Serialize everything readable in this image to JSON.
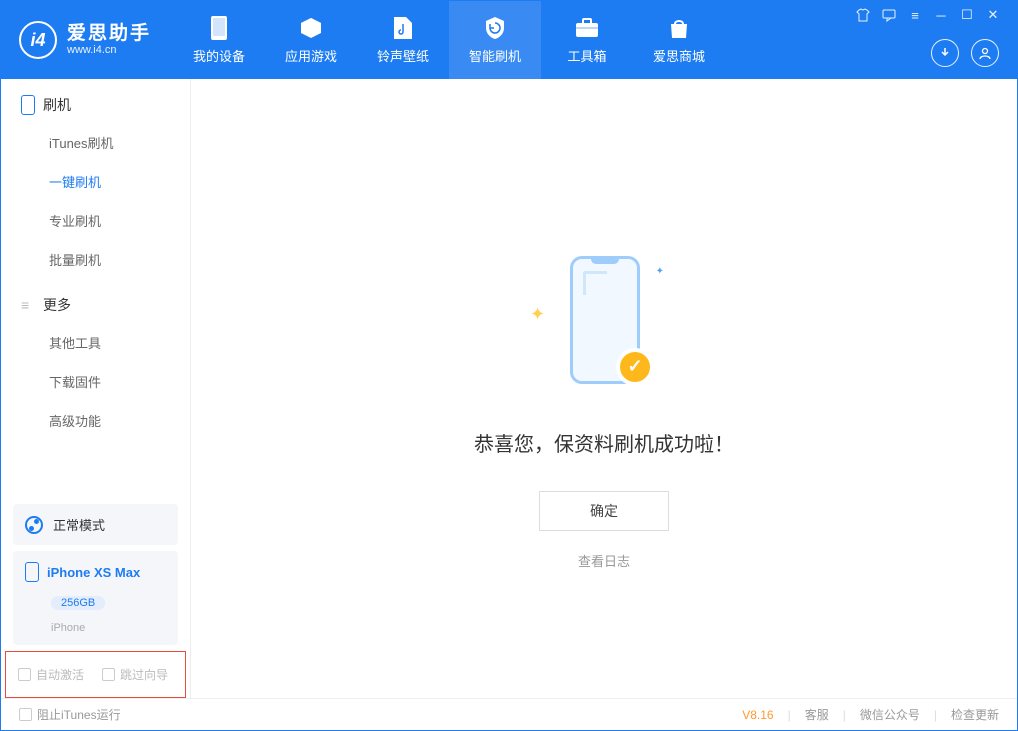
{
  "brand": {
    "name": "爱思助手",
    "url": "www.i4.cn"
  },
  "nav": {
    "items": [
      {
        "label": "我的设备"
      },
      {
        "label": "应用游戏"
      },
      {
        "label": "铃声壁纸"
      },
      {
        "label": "智能刷机"
      },
      {
        "label": "工具箱"
      },
      {
        "label": "爱思商城"
      }
    ]
  },
  "sidebar": {
    "section1": {
      "title": "刷机",
      "items": [
        "iTunes刷机",
        "一键刷机",
        "专业刷机",
        "批量刷机"
      ]
    },
    "section2": {
      "title": "更多",
      "items": [
        "其他工具",
        "下载固件",
        "高级功能"
      ]
    },
    "mode": "正常模式",
    "device": {
      "name": "iPhone XS Max",
      "capacity": "256GB",
      "type": "iPhone"
    },
    "checkboxes": {
      "auto_activate": "自动激活",
      "skip_guide": "跳过向导"
    }
  },
  "content": {
    "success_message": "恭喜您，保资料刷机成功啦！",
    "ok_button": "确定",
    "view_log": "查看日志"
  },
  "footer": {
    "block_itunes": "阻止iTunes运行",
    "version": "V8.16",
    "links": {
      "service": "客服",
      "wechat": "微信公众号",
      "update": "检查更新"
    }
  }
}
